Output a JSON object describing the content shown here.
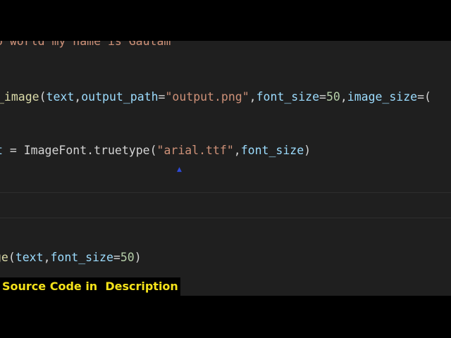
{
  "code": {
    "line1": {
      "text": "o world my name is Gautam\""
    },
    "line2": {
      "fn": "_image",
      "open": "(",
      "p1": "text",
      "c1": ",",
      "p2": "output_path",
      "eq1": "=",
      "s1": "\"output.png\"",
      "c2": ",",
      "p3": "font_size",
      "eq2": "=",
      "n1": "50",
      "c3": ",",
      "p4": "image_size",
      "eq3": "=",
      "tail": "("
    },
    "line3": {
      "var": "t",
      "assign": " = ",
      "cls": "ImageFont",
      "dot": ".",
      "method": "truetype",
      "open": "(",
      "s1": "\"arial.ttf\"",
      "c1": ",",
      "p1": "font_size",
      "close": ")"
    },
    "line4": {
      "fn": "ge",
      "open": "(",
      "p1": "text",
      "c1": ",",
      "p2": "font_size",
      "eq1": "=",
      "n1": "50",
      "close": ")"
    }
  },
  "overlay": {
    "caption": "Source Code in  Description",
    "caption_color": "#f4e21a"
  },
  "theme": {
    "editor_bg": "#1f1f1f",
    "string_color": "#ce9178",
    "function_color": "#dcdcaa",
    "variable_color": "#9cdcfe",
    "number_color": "#b5cea8"
  }
}
